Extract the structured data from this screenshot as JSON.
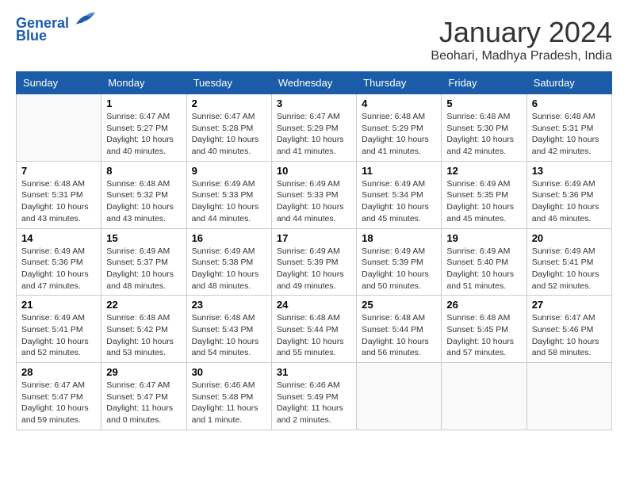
{
  "header": {
    "logo_line1": "General",
    "logo_line2": "Blue",
    "month_year": "January 2024",
    "location": "Beohari, Madhya Pradesh, India"
  },
  "days_of_week": [
    "Sunday",
    "Monday",
    "Tuesday",
    "Wednesday",
    "Thursday",
    "Friday",
    "Saturday"
  ],
  "weeks": [
    [
      {
        "day": "",
        "sunrise": "",
        "sunset": "",
        "daylight": ""
      },
      {
        "day": "1",
        "sunrise": "Sunrise: 6:47 AM",
        "sunset": "Sunset: 5:27 PM",
        "daylight": "Daylight: 10 hours and 40 minutes."
      },
      {
        "day": "2",
        "sunrise": "Sunrise: 6:47 AM",
        "sunset": "Sunset: 5:28 PM",
        "daylight": "Daylight: 10 hours and 40 minutes."
      },
      {
        "day": "3",
        "sunrise": "Sunrise: 6:47 AM",
        "sunset": "Sunset: 5:29 PM",
        "daylight": "Daylight: 10 hours and 41 minutes."
      },
      {
        "day": "4",
        "sunrise": "Sunrise: 6:48 AM",
        "sunset": "Sunset: 5:29 PM",
        "daylight": "Daylight: 10 hours and 41 minutes."
      },
      {
        "day": "5",
        "sunrise": "Sunrise: 6:48 AM",
        "sunset": "Sunset: 5:30 PM",
        "daylight": "Daylight: 10 hours and 42 minutes."
      },
      {
        "day": "6",
        "sunrise": "Sunrise: 6:48 AM",
        "sunset": "Sunset: 5:31 PM",
        "daylight": "Daylight: 10 hours and 42 minutes."
      }
    ],
    [
      {
        "day": "7",
        "sunrise": "Sunrise: 6:48 AM",
        "sunset": "Sunset: 5:31 PM",
        "daylight": "Daylight: 10 hours and 43 minutes."
      },
      {
        "day": "8",
        "sunrise": "Sunrise: 6:48 AM",
        "sunset": "Sunset: 5:32 PM",
        "daylight": "Daylight: 10 hours and 43 minutes."
      },
      {
        "day": "9",
        "sunrise": "Sunrise: 6:49 AM",
        "sunset": "Sunset: 5:33 PM",
        "daylight": "Daylight: 10 hours and 44 minutes."
      },
      {
        "day": "10",
        "sunrise": "Sunrise: 6:49 AM",
        "sunset": "Sunset: 5:33 PM",
        "daylight": "Daylight: 10 hours and 44 minutes."
      },
      {
        "day": "11",
        "sunrise": "Sunrise: 6:49 AM",
        "sunset": "Sunset: 5:34 PM",
        "daylight": "Daylight: 10 hours and 45 minutes."
      },
      {
        "day": "12",
        "sunrise": "Sunrise: 6:49 AM",
        "sunset": "Sunset: 5:35 PM",
        "daylight": "Daylight: 10 hours and 45 minutes."
      },
      {
        "day": "13",
        "sunrise": "Sunrise: 6:49 AM",
        "sunset": "Sunset: 5:36 PM",
        "daylight": "Daylight: 10 hours and 46 minutes."
      }
    ],
    [
      {
        "day": "14",
        "sunrise": "Sunrise: 6:49 AM",
        "sunset": "Sunset: 5:36 PM",
        "daylight": "Daylight: 10 hours and 47 minutes."
      },
      {
        "day": "15",
        "sunrise": "Sunrise: 6:49 AM",
        "sunset": "Sunset: 5:37 PM",
        "daylight": "Daylight: 10 hours and 48 minutes."
      },
      {
        "day": "16",
        "sunrise": "Sunrise: 6:49 AM",
        "sunset": "Sunset: 5:38 PM",
        "daylight": "Daylight: 10 hours and 48 minutes."
      },
      {
        "day": "17",
        "sunrise": "Sunrise: 6:49 AM",
        "sunset": "Sunset: 5:39 PM",
        "daylight": "Daylight: 10 hours and 49 minutes."
      },
      {
        "day": "18",
        "sunrise": "Sunrise: 6:49 AM",
        "sunset": "Sunset: 5:39 PM",
        "daylight": "Daylight: 10 hours and 50 minutes."
      },
      {
        "day": "19",
        "sunrise": "Sunrise: 6:49 AM",
        "sunset": "Sunset: 5:40 PM",
        "daylight": "Daylight: 10 hours and 51 minutes."
      },
      {
        "day": "20",
        "sunrise": "Sunrise: 6:49 AM",
        "sunset": "Sunset: 5:41 PM",
        "daylight": "Daylight: 10 hours and 52 minutes."
      }
    ],
    [
      {
        "day": "21",
        "sunrise": "Sunrise: 6:49 AM",
        "sunset": "Sunset: 5:41 PM",
        "daylight": "Daylight: 10 hours and 52 minutes."
      },
      {
        "day": "22",
        "sunrise": "Sunrise: 6:48 AM",
        "sunset": "Sunset: 5:42 PM",
        "daylight": "Daylight: 10 hours and 53 minutes."
      },
      {
        "day": "23",
        "sunrise": "Sunrise: 6:48 AM",
        "sunset": "Sunset: 5:43 PM",
        "daylight": "Daylight: 10 hours and 54 minutes."
      },
      {
        "day": "24",
        "sunrise": "Sunrise: 6:48 AM",
        "sunset": "Sunset: 5:44 PM",
        "daylight": "Daylight: 10 hours and 55 minutes."
      },
      {
        "day": "25",
        "sunrise": "Sunrise: 6:48 AM",
        "sunset": "Sunset: 5:44 PM",
        "daylight": "Daylight: 10 hours and 56 minutes."
      },
      {
        "day": "26",
        "sunrise": "Sunrise: 6:48 AM",
        "sunset": "Sunset: 5:45 PM",
        "daylight": "Daylight: 10 hours and 57 minutes."
      },
      {
        "day": "27",
        "sunrise": "Sunrise: 6:47 AM",
        "sunset": "Sunset: 5:46 PM",
        "daylight": "Daylight: 10 hours and 58 minutes."
      }
    ],
    [
      {
        "day": "28",
        "sunrise": "Sunrise: 6:47 AM",
        "sunset": "Sunset: 5:47 PM",
        "daylight": "Daylight: 10 hours and 59 minutes."
      },
      {
        "day": "29",
        "sunrise": "Sunrise: 6:47 AM",
        "sunset": "Sunset: 5:47 PM",
        "daylight": "Daylight: 11 hours and 0 minutes."
      },
      {
        "day": "30",
        "sunrise": "Sunrise: 6:46 AM",
        "sunset": "Sunset: 5:48 PM",
        "daylight": "Daylight: 11 hours and 1 minute."
      },
      {
        "day": "31",
        "sunrise": "Sunrise: 6:46 AM",
        "sunset": "Sunset: 5:49 PM",
        "daylight": "Daylight: 11 hours and 2 minutes."
      },
      {
        "day": "",
        "sunrise": "",
        "sunset": "",
        "daylight": ""
      },
      {
        "day": "",
        "sunrise": "",
        "sunset": "",
        "daylight": ""
      },
      {
        "day": "",
        "sunrise": "",
        "sunset": "",
        "daylight": ""
      }
    ]
  ]
}
